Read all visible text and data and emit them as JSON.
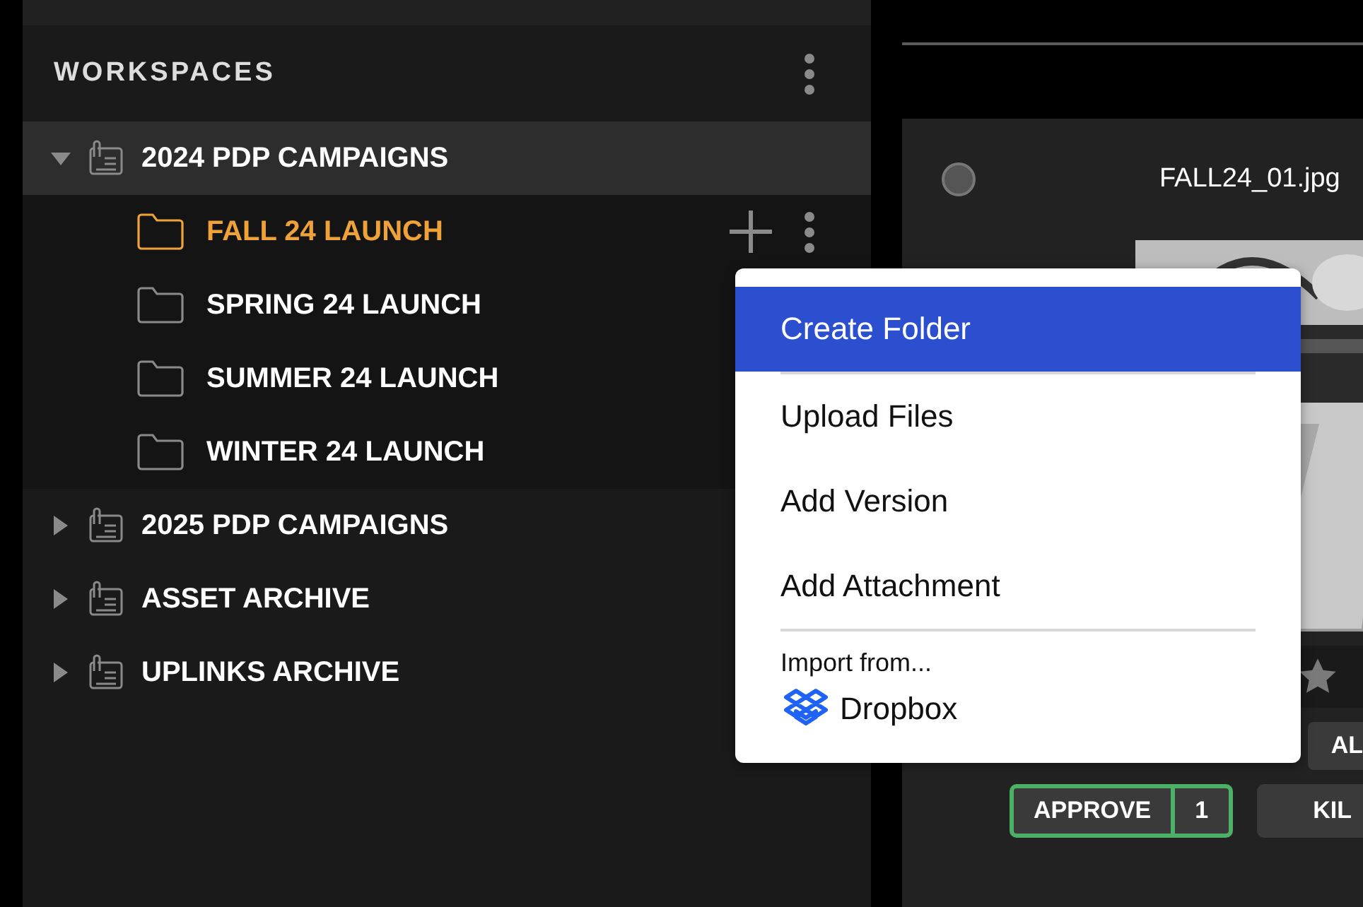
{
  "sidebar": {
    "title": "WORKSPACES",
    "workspaces": [
      {
        "label": "2024 PDP CAMPAIGNS",
        "expanded": true,
        "selected": true,
        "children": [
          {
            "label": "FALL 24 LAUNCH",
            "selected": true
          },
          {
            "label": "SPRING 24 LAUNCH",
            "selected": false
          },
          {
            "label": "SUMMER 24 LAUNCH",
            "selected": false
          },
          {
            "label": "WINTER 24 LAUNCH",
            "selected": false
          }
        ]
      },
      {
        "label": "2025 PDP CAMPAIGNS",
        "expanded": false,
        "selected": false
      },
      {
        "label": "ASSET ARCHIVE",
        "expanded": false,
        "selected": false
      },
      {
        "label": "UPLINKS ARCHIVE",
        "expanded": false,
        "selected": false
      }
    ]
  },
  "context_menu": {
    "items": [
      {
        "label": "Create Folder",
        "selected": true
      },
      {
        "label": "Upload Files",
        "selected": false
      },
      {
        "label": "Add Version",
        "selected": false
      },
      {
        "label": "Add Attachment",
        "selected": false
      }
    ],
    "import_heading": "Import from...",
    "import_source": "Dropbox"
  },
  "asset_card": {
    "filename": "FALL24_01.jpg",
    "checked": false,
    "buttons": [
      "AL"
    ],
    "approve": {
      "label": "APPROVE",
      "count": "1"
    },
    "kill_label": "KIL"
  }
}
